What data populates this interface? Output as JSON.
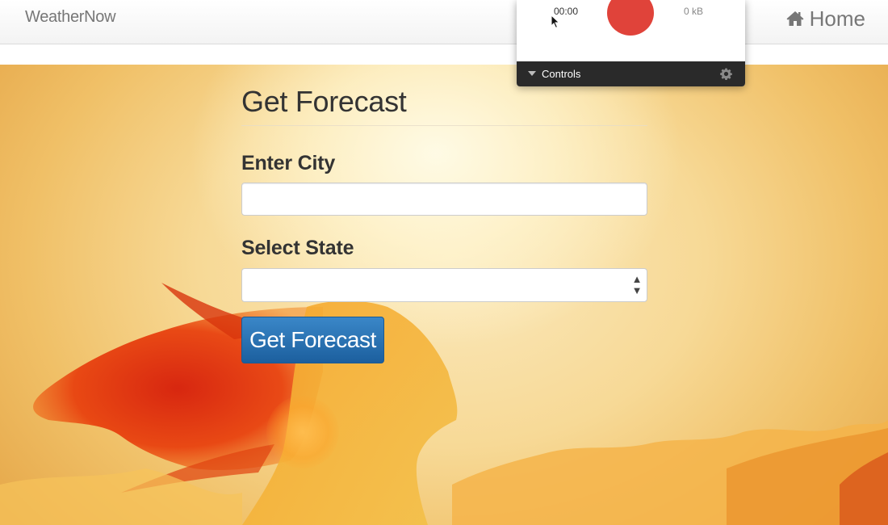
{
  "navbar": {
    "brand": "WeatherNow",
    "home_label": "Home",
    "home_icon": "home-icon"
  },
  "form": {
    "title": "Get Forecast",
    "city_label": "Enter City",
    "city_value": "",
    "state_label": "Select State",
    "state_value": "",
    "submit_label": "Get Forecast"
  },
  "recorder": {
    "time": "00:00",
    "size": "0 kB",
    "controls_label": "Controls",
    "record_color": "#e0433a",
    "settings_icon": "gear-icon"
  },
  "colors": {
    "button_primary": "#2a73b5",
    "navbar_text": "#777777",
    "heading_text": "#333333"
  }
}
